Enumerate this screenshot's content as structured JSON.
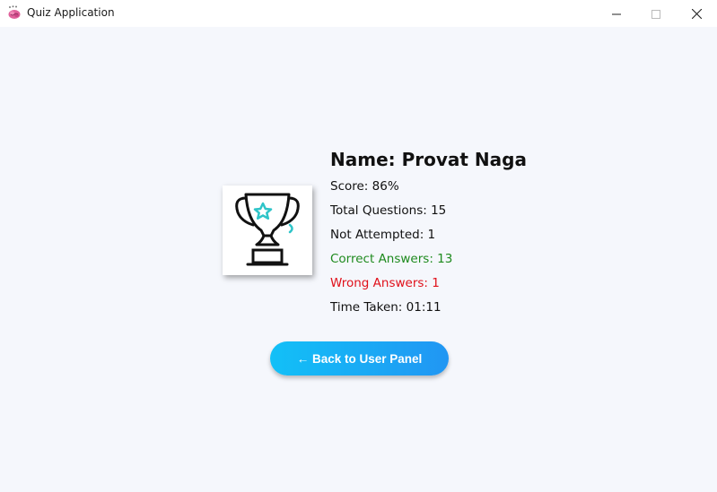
{
  "window": {
    "title": "Quiz Application",
    "app_icon": "brain-icon",
    "controls": [
      "minimize-icon",
      "maximize-icon",
      "close-icon"
    ]
  },
  "result": {
    "name_label": "Name: Provat Naga",
    "score_label": "Score: 86%",
    "total_questions_label": "Total Questions: 15",
    "not_attempted_label": "Not Attempted: 1",
    "correct_answers_label": "Correct Answers: 13",
    "wrong_answers_label": "Wrong Answers: 1",
    "time_taken_label": "Time Taken: 01:11",
    "trophy_icon": "trophy-icon",
    "colors": {
      "correct": "#1e8a1e",
      "wrong": "#e0101a"
    }
  },
  "actions": {
    "back_label": "← Back to User Panel",
    "accent_start": "#12c0f7",
    "accent_end": "#2196f3"
  }
}
